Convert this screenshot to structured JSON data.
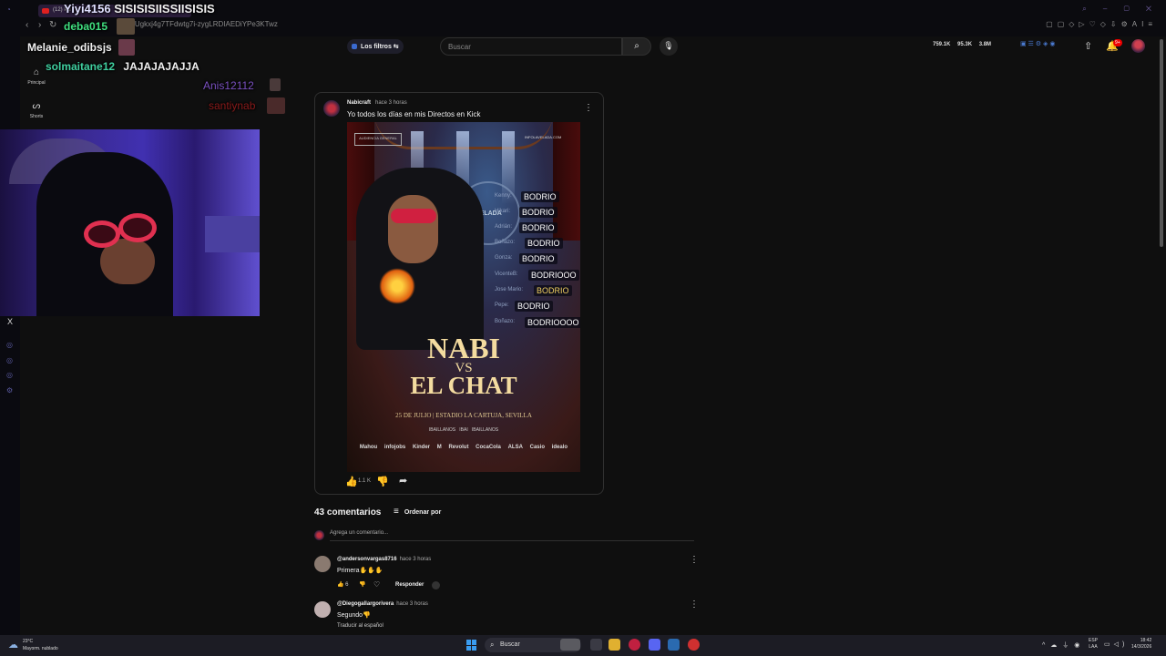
{
  "browser": {
    "tab_title": "(12) Pu",
    "url": "ost/Ugkxj4g7TFdwtg7i-zygLRDIAEDiYPe3KTwz"
  },
  "chat_overlay": [
    {
      "user": "Yiyi4156",
      "message": "SISISISIISSIISISIS",
      "user_color": "#e0e0ff",
      "msg_color": "#ffffff"
    },
    {
      "user": "deba015",
      "message": "",
      "user_color": "#40e080",
      "msg_color": "#ffffff"
    },
    {
      "user": "Melanie_odibsjs",
      "message": "",
      "user_color": "#ffffff",
      "msg_color": "#ffffff"
    },
    {
      "user": "solmaitane12",
      "message": "JAJAJAJAJJA",
      "user_color": "#40d0a0",
      "msg_color": "#ffffff"
    },
    {
      "user": "Anis12112",
      "message": "",
      "user_color": "#7a50c0",
      "msg_color": "#ffffff"
    },
    {
      "user": "santiynab",
      "message": "",
      "user_color": "#8a1a1a",
      "msg_color": "#ffffff"
    }
  ],
  "youtube": {
    "filters_label": "Los filtros",
    "search_placeholder": "Buscar",
    "stats": [
      "759.1K",
      "95.3K",
      "3.8M"
    ],
    "notif_count": "9+",
    "sidebar": [
      {
        "label": "Principal",
        "icon": "home-icon"
      },
      {
        "label": "Shorts",
        "icon": "shorts-icon"
      }
    ]
  },
  "post": {
    "channel": "Nabicraft",
    "time": "hace 3 horas",
    "text": "Yo todos los días en mis Directos en Kick",
    "likes": "1.1 K",
    "poster": {
      "badge": "AUDIENCIA GENERAL",
      "website": "INFOLAVELADA.COM",
      "ring_text": "VELADA",
      "rankings": [
        {
          "name": "Kenny:",
          "verdict": "BODRIO"
        },
        {
          "name": "Hikari:",
          "verdict": "BODRIO"
        },
        {
          "name": "Adrián:",
          "verdict": "BODRIO"
        },
        {
          "name": "Boñazo:",
          "verdict": "BODRIO"
        },
        {
          "name": "Gonza:",
          "verdict": "BODRIO"
        },
        {
          "name": "VicenteB:",
          "verdict": "BODRIOOO"
        },
        {
          "name": "Jose Mario:",
          "verdict": "BODRIO"
        },
        {
          "name": "Pepe:",
          "verdict": "BODRIO"
        },
        {
          "name": "Boñazo:",
          "verdict": "BODRIOOOO"
        }
      ],
      "title_1": "NABI",
      "title_vs": "VS",
      "title_2": "EL CHAT",
      "date_line": "25 DE JULIO | ESTADIO LA CARTUJA, SEVILLA",
      "socials": [
        "IBAILLANOS",
        "IBAI",
        "IBAILLANOS"
      ],
      "sponsors": [
        "Mahou",
        "infojobs",
        "Kinder",
        "M",
        "Revolut",
        "CocaCola",
        "ALSA",
        "Casio",
        "idealo"
      ]
    }
  },
  "comments": {
    "count_label": "43 comentarios",
    "sort_label": "Ordenar por",
    "add_placeholder": "Agrega un comentario...",
    "items": [
      {
        "user": "@andersonvargas8716",
        "time": "hace 3 horas",
        "text": "Primera✋✋✋",
        "likes": "6",
        "reply": "Responder",
        "extra": ""
      },
      {
        "user": "@Diegogallargorivera",
        "time": "hace 3 horas",
        "text": "Segundo👎",
        "likes": "",
        "reply": "",
        "extra": "Traducir al español"
      }
    ]
  },
  "taskbar": {
    "temp": "23°C",
    "weather": "Mayorm. nublado",
    "search": "Buscar",
    "lang_1": "ESP",
    "lang_2": "LAA",
    "time": "18:42",
    "date": "14/3/2026"
  },
  "misc": {
    "close_x": "X"
  }
}
